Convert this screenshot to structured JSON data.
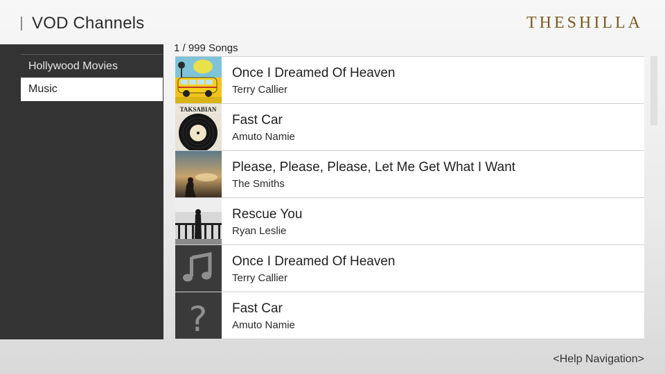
{
  "header": {
    "title": "VOD Channels",
    "brand": "THESHILLA"
  },
  "sidebar": {
    "items": [
      {
        "label": "Hollywood Movies",
        "selected": false
      },
      {
        "label": "Music",
        "selected": true
      }
    ]
  },
  "list": {
    "count_label": "1 / 999 Songs",
    "items": [
      {
        "title": "Once I Dreamed Of Heaven",
        "artist": "Terry Callier",
        "art": "yellow-van-album-art"
      },
      {
        "title": "Fast Car",
        "artist": "Amuto Namie",
        "art": "vinyl-record-album-art"
      },
      {
        "title": "Please, Please, Please, Let Me Get What I Want",
        "artist": "The Smiths",
        "art": "sunset-silhouette-album-art"
      },
      {
        "title": "Rescue You",
        "artist": "Ryan Leslie",
        "art": "bw-balcony-album-art"
      },
      {
        "title": "Once I Dreamed Of Heaven",
        "artist": "Terry Callier",
        "art": "music-note-icon"
      },
      {
        "title": "Fast Car",
        "artist": "Amuto Namie",
        "art": "question-mark-icon"
      }
    ]
  },
  "footer": {
    "help": "<Help Navigation>"
  },
  "colors": {
    "sidebar_bg": "#333333",
    "brand_gold": "#7a5a22",
    "placeholder_bg": "#3a3a3a"
  }
}
